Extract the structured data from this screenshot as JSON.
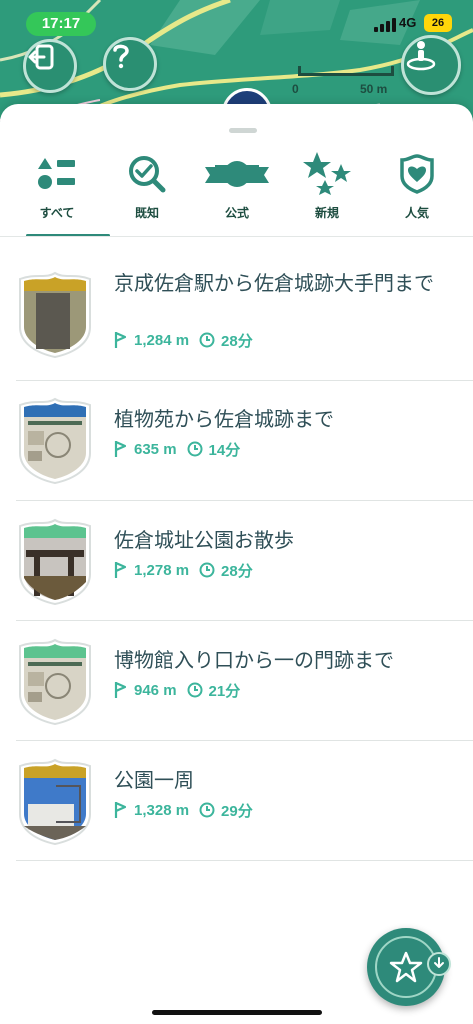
{
  "status_bar": {
    "time": "17:17",
    "network": "4G",
    "battery": "26"
  },
  "map": {
    "scale_start": "0",
    "scale_end": "50 m"
  },
  "tabs": [
    {
      "label": "すべて",
      "icon": "all-categories-icon",
      "active": true
    },
    {
      "label": "既知",
      "icon": "magnifier-check-icon",
      "active": false
    },
    {
      "label": "公式",
      "icon": "ribbon-icon",
      "active": false
    },
    {
      "label": "新規",
      "icon": "stars-icon",
      "active": false
    },
    {
      "label": "人気",
      "icon": "heart-shield-icon",
      "active": false
    }
  ],
  "courses": [
    {
      "title": "京成佐倉駅から佐倉城跡大手門まで",
      "distance": "1,284 m",
      "duration": "28分",
      "thumb": "stone-monument",
      "badge_color": "#c9a227"
    },
    {
      "title": "植物苑から佐倉城跡まで",
      "distance": "635 m",
      "duration": "14分",
      "thumb": "info-board",
      "badge_color": "#2f6fb5"
    },
    {
      "title": "佐倉城址公園お散歩",
      "distance": "1,278 m",
      "duration": "28分",
      "thumb": "park-gate",
      "badge_color": "#5cc38f"
    },
    {
      "title": "博物館入り口から一の門跡まで",
      "distance": "946 m",
      "duration": "21分",
      "thumb": "info-board",
      "badge_color": "#5cc38f"
    },
    {
      "title": "公園一周",
      "distance": "1,328 m",
      "duration": "29分",
      "thumb": "building",
      "badge_color": "#c9a227"
    }
  ],
  "colors": {
    "accent": "#2e8a7a",
    "meta": "#3cb59c",
    "map": "#2e9b7b"
  }
}
